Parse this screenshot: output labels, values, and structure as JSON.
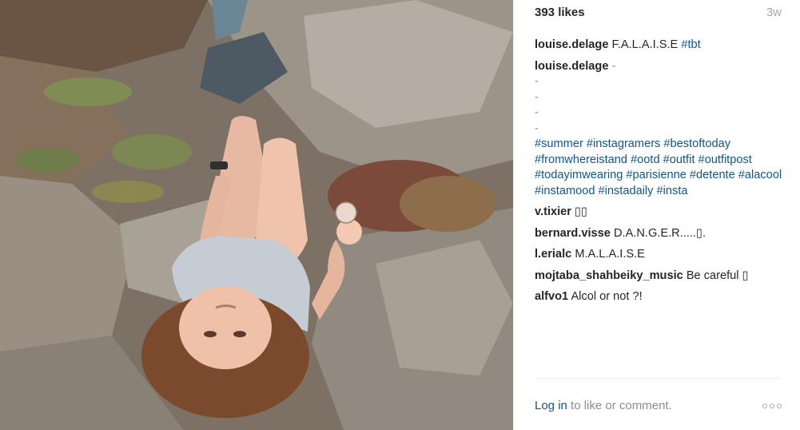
{
  "post": {
    "likes": "393 likes",
    "time_ago": "3w"
  },
  "caption": {
    "user": "louise.delage",
    "text": "F.A.L.A.I.S.E",
    "hashtag": "#tbt"
  },
  "comments": [
    {
      "user": "louise.delage",
      "text": "-",
      "dashes": [
        "-",
        "-",
        "-",
        "-"
      ],
      "hashtags": [
        "#summer",
        "#instagramers",
        "#bestoftoday",
        "#fromwhereistand",
        "#ootd",
        "#outfit",
        "#outfitpost",
        "#todayimwearing",
        "#parisienne",
        "#detente",
        "#alacool",
        "#instamood",
        "#instadaily",
        "#insta"
      ]
    },
    {
      "user": "v.tixier",
      "text": "▯▯"
    },
    {
      "user": "bernard.visse",
      "text": "D.A.N.G.E.R.....▯."
    },
    {
      "user": "l.erialc",
      "text": "M.A.L.A.I.S.E"
    },
    {
      "user": "mojtaba_shahbeiky_music",
      "text": "Be careful ▯"
    },
    {
      "user": "alfvo1",
      "text": "Alcol or not ?!"
    }
  ],
  "footer": {
    "login_label": "Log in",
    "rest": " to like or comment.",
    "more_icon": "more-options-icon"
  },
  "photo": {
    "icon": "photo-image"
  },
  "colors": {
    "link": "#125688",
    "muted": "#8e8e8e",
    "text": "#262626"
  }
}
